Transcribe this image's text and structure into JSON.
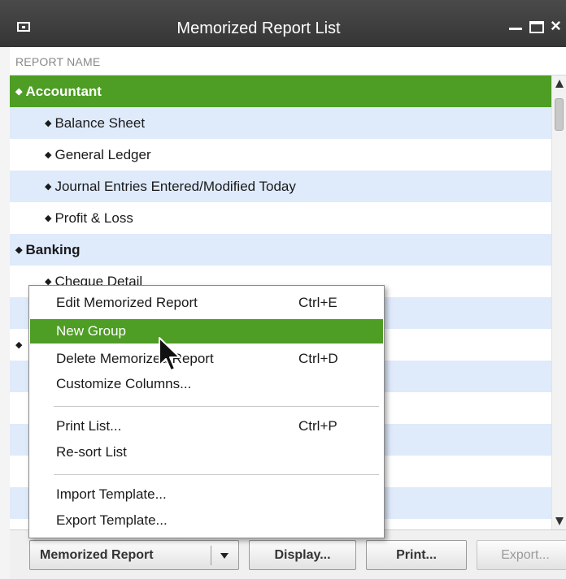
{
  "window": {
    "title": "Memorized Report List",
    "controls": [
      "system-menu",
      "minimize",
      "maximize",
      "close"
    ]
  },
  "list": {
    "column_header": "REPORT NAME",
    "rows": [
      {
        "label": "Accountant",
        "type": "group",
        "selected": true
      },
      {
        "label": "Balance Sheet",
        "type": "item"
      },
      {
        "label": "General Ledger",
        "type": "item"
      },
      {
        "label": "Journal Entries Entered/Modified Today",
        "type": "item"
      },
      {
        "label": "Profit & Loss",
        "type": "item"
      },
      {
        "label": "Banking",
        "type": "group"
      },
      {
        "label": "Cheque Detail",
        "type": "item"
      }
    ]
  },
  "context_menu": {
    "items": [
      {
        "label": "Edit Memorized Report",
        "shortcut": "Ctrl+E"
      },
      {
        "label": "New Group",
        "highlighted": true
      },
      {
        "label": "Delete Memorized Report",
        "shortcut": "Ctrl+D"
      },
      {
        "label": "Customize Columns..."
      },
      {
        "label": "Print List...",
        "shortcut": "Ctrl+P"
      },
      {
        "label": "Re-sort List"
      },
      {
        "label": "Import Template..."
      },
      {
        "label": "Export Template..."
      }
    ]
  },
  "toolbar": {
    "memorized_report_label": "Memorized Report",
    "display_label": "Display...",
    "print_label": "Print...",
    "export_label": "Export..."
  },
  "colors": {
    "selection_green": "#4e9d24",
    "alt_row_blue": "#dfeafb",
    "title_bar": "#3c3c3c"
  }
}
